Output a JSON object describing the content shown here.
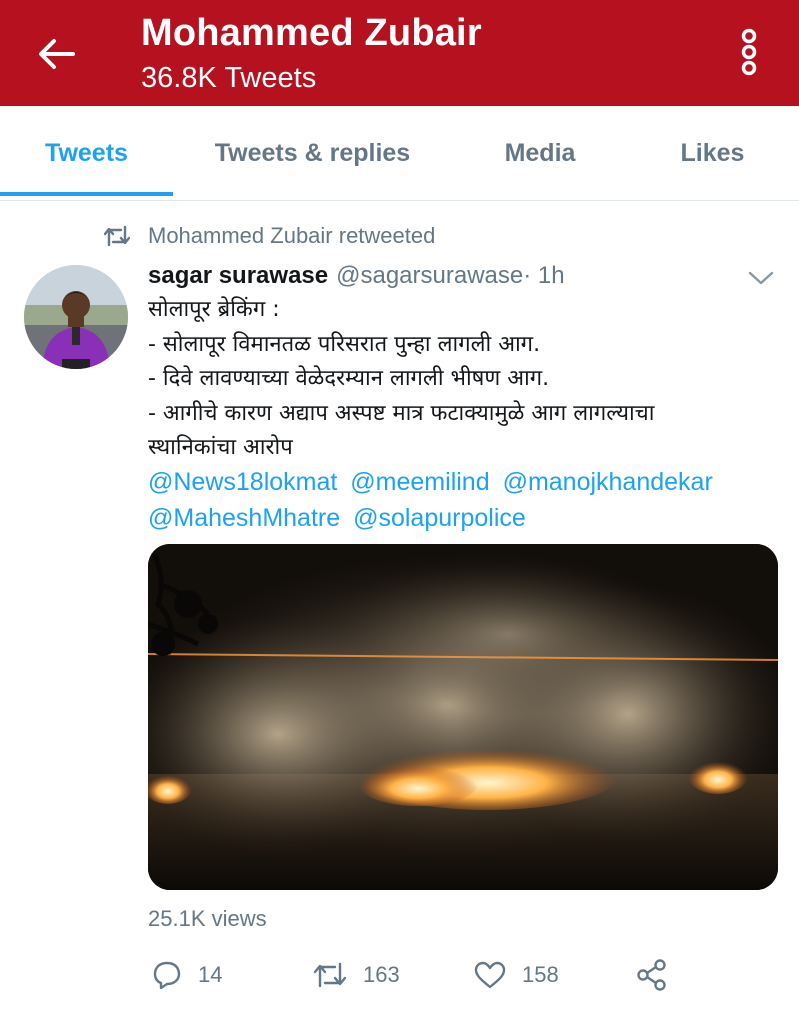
{
  "header": {
    "title": "Mohammed Zubair",
    "subtitle": "36.8K Tweets",
    "back_icon": "arrow-left-icon",
    "more_icon": "vertical-dots-icon",
    "background_color": "#b5111e"
  },
  "tabs": [
    {
      "label": "Tweets",
      "active": true
    },
    {
      "label": "Tweets & replies",
      "active": false
    },
    {
      "label": "Media",
      "active": false
    },
    {
      "label": "Likes",
      "active": false
    }
  ],
  "accent_color": "#1da1f2",
  "tweet": {
    "retweet_context": "Mohammed Zubair retweeted",
    "author_name": "sagar surawase",
    "author_handle": "@sagarsurawase",
    "time": " · 1h",
    "text_lines": [
      "सोलापूर ब्रेकिंग :",
      "- सोलापूर विमानतळ परिसरात पुन्हा लागली आग.",
      "- दिवे लावण्याच्या वेळेदरम्यान लागली भीषण आग.",
      "- आगीचे कारण अद्याप अस्पष्ट मात्र फटाक्यामुळे आग लागल्याचा",
      "स्थानिकांचा आरोप"
    ],
    "mentions_line1": [
      "@News18lokmat",
      "@meemilind",
      "@manojkhandekar"
    ],
    "mentions_line2": [
      "@MaheshMhatre",
      "@solapurpolice"
    ],
    "views": "25.1K views",
    "replies": "14",
    "retweets": "163",
    "likes": "158"
  }
}
